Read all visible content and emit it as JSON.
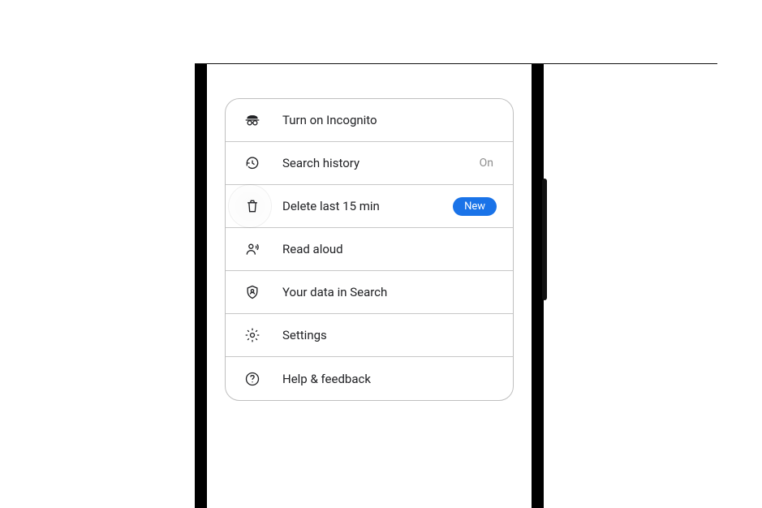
{
  "menu": {
    "items": [
      {
        "icon": "incognito-icon",
        "label": "Turn on Incognito"
      },
      {
        "icon": "history-icon",
        "label": "Search history",
        "trailing": "On"
      },
      {
        "icon": "trash-icon",
        "label": "Delete last 15 min",
        "badge": "New",
        "highlighted": true
      },
      {
        "icon": "read-aloud-icon",
        "label": "Read aloud"
      },
      {
        "icon": "shield-icon",
        "label": "Your data in Search"
      },
      {
        "icon": "settings-icon",
        "label": "Settings"
      },
      {
        "icon": "help-icon",
        "label": "Help & feedback"
      }
    ]
  },
  "colors": {
    "accent": "#1a73e8"
  }
}
